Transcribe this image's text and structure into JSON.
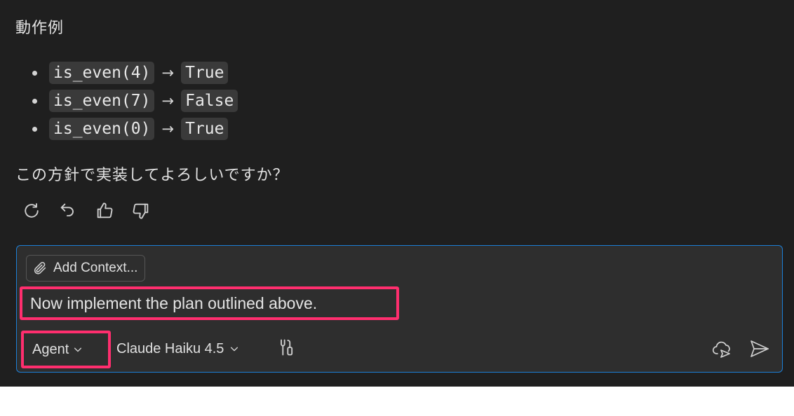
{
  "message": {
    "heading": "動作例",
    "examples": [
      {
        "call": "is_even(4)",
        "arrow": "→",
        "result": "True"
      },
      {
        "call": "is_even(7)",
        "arrow": "→",
        "result": "False"
      },
      {
        "call": "is_even(0)",
        "arrow": "→",
        "result": "True"
      }
    ],
    "question": "この方針で実装してよろしいですか？",
    "actions": [
      "retry-icon",
      "undo-icon",
      "thumbs-up-icon",
      "thumbs-down-icon"
    ]
  },
  "chat_input": {
    "add_context_label": "Add Context...",
    "prompt_text": "Now implement the plan outlined above.",
    "mode_label": "Agent",
    "model_label": "Claude Haiku 4.5",
    "icons": [
      "paperclip-icon",
      "tools-icon",
      "cloud-delegate-icon",
      "send-icon"
    ]
  },
  "colors": {
    "panel_bg": "#1f1f1f",
    "input_border": "#1c7fd6",
    "highlight": "#ff2e6e"
  }
}
